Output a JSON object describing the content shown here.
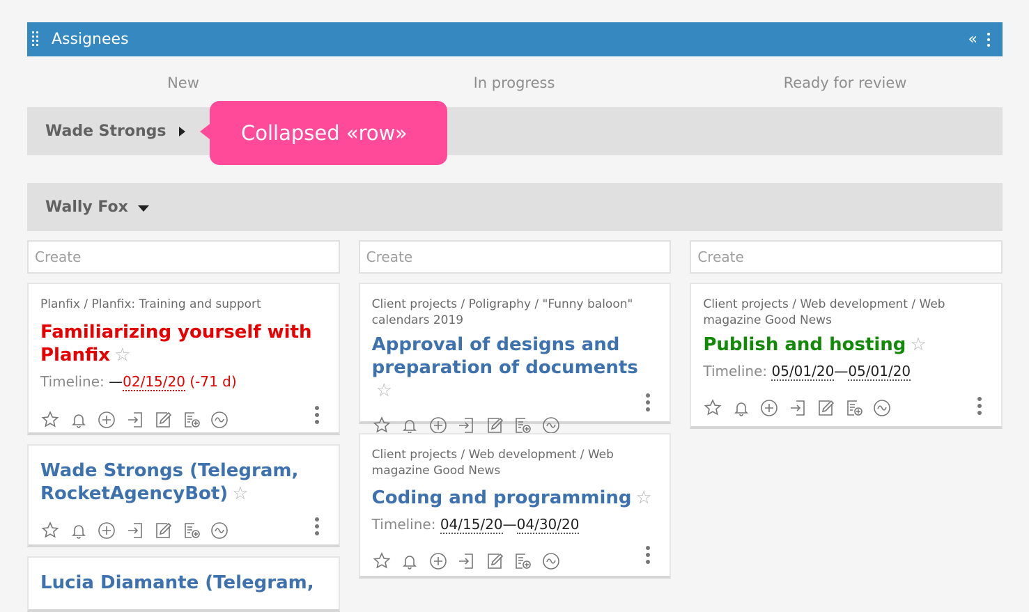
{
  "header": {
    "title": "Assignees"
  },
  "columns": [
    "New",
    "In progress",
    "Ready for review"
  ],
  "groups": [
    {
      "name": "Wade Strongs",
      "state": "collapsed"
    },
    {
      "name": "Wally Fox",
      "state": "expanded"
    }
  ],
  "tooltip": "Collapsed «row»",
  "create_placeholder": "Create",
  "timeline_label": "Timeline:",
  "cards": {
    "c1": {
      "path": "Planfix / Planfix: Training and support",
      "title": "Familiarizing yourself with Planfix",
      "timeline_prefix": "—",
      "date_end": "02/15/20",
      "overdue": "(-71 d)"
    },
    "c2": {
      "title": "Wade Strongs (Telegram, RocketAgencyBot)"
    },
    "c3": {
      "title": "Lucia Diamante (Telegram,"
    },
    "c4": {
      "path": "Client projects / Poligraphy / \"Funny baloon\" calendars 2019",
      "title": "Approval of designs and preparation of documents"
    },
    "c5": {
      "path": "Client projects / Web development / Web magazine Good News",
      "title": "Coding and programming",
      "date_start": "04/15/20",
      "date_end": "04/30/20"
    },
    "c6": {
      "path": "Client projects / Web development / Web magazine Good News",
      "title": "Publish and hosting",
      "date_start": "05/01/20",
      "date_end": "05/01/20"
    }
  },
  "colors": {
    "header_bg": "#3689c0",
    "tooltip_bg": "#ff4a9a",
    "overdue": "#e60000",
    "link_blue": "#3e72ae",
    "done_green": "#138a07"
  },
  "icons": [
    "star-icon",
    "bell-icon",
    "plus-circle-icon",
    "enter-icon",
    "edit-icon",
    "add-list-icon",
    "wave-icon",
    "more-icon"
  ]
}
